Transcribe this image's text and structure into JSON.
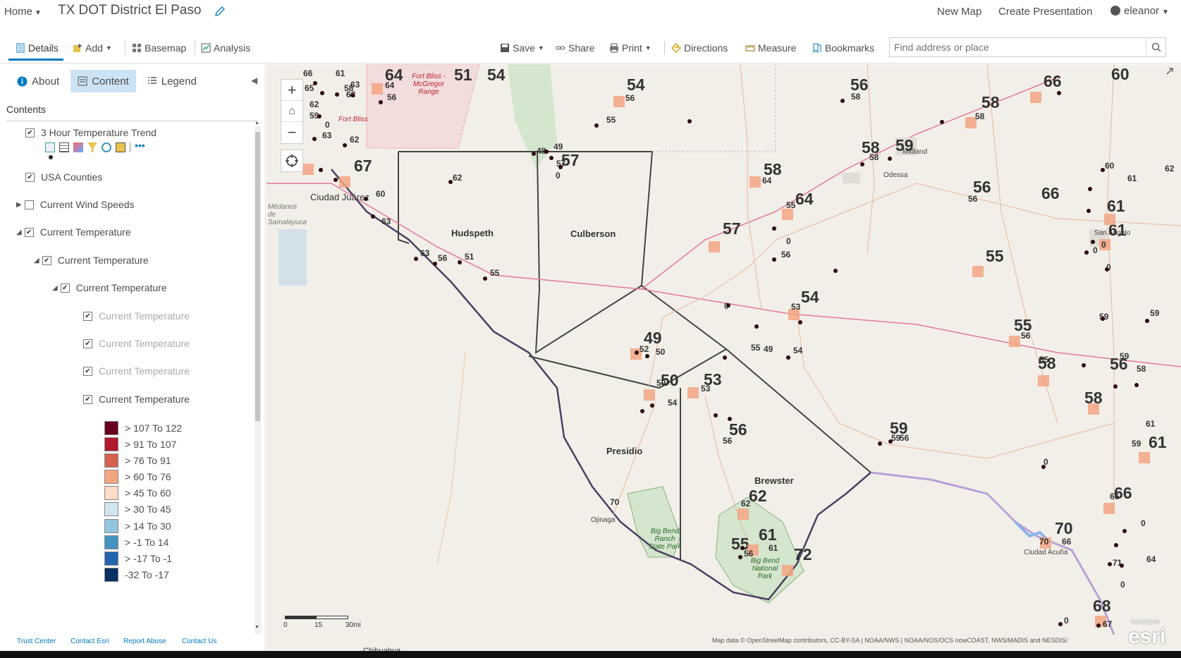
{
  "header": {
    "home_label": "Home",
    "map_title": "TX DOT District El Paso",
    "new_map": "New Map",
    "create_presentation": "Create Presentation",
    "user": "eleanor"
  },
  "toolbar": {
    "details": "Details",
    "add": "Add",
    "basemap": "Basemap",
    "analysis": "Analysis",
    "save": "Save",
    "share": "Share",
    "print": "Print",
    "directions": "Directions",
    "measure": "Measure",
    "bookmarks": "Bookmarks",
    "search_placeholder": "Find address or place"
  },
  "panel": {
    "tabs": [
      "About",
      "Content",
      "Legend"
    ],
    "contents_heading": "Contents",
    "layers": [
      {
        "label": "3 Hour Temperature Trend",
        "checked": true
      },
      {
        "label": "USA Counties",
        "checked": true
      },
      {
        "label": "Current Wind Speeds",
        "checked": false
      },
      {
        "label": "Current Temperature",
        "checked": true
      },
      {
        "label": "Current Temperature",
        "checked": true
      },
      {
        "label": "Current Temperature",
        "checked": true
      },
      {
        "label": "Current Temperature",
        "checked": true
      },
      {
        "label": "Current Temperature",
        "checked": true
      },
      {
        "label": "Current Temperature",
        "checked": true
      },
      {
        "label": "Current Temperature",
        "checked": true
      }
    ],
    "legend": [
      {
        "label": "> 107 To 122",
        "color": "#67001f"
      },
      {
        "label": "> 91 To 107",
        "color": "#b2182b"
      },
      {
        "label": "> 76 To 91",
        "color": "#d6604d"
      },
      {
        "label": "> 60 To 76",
        "color": "#f4a582"
      },
      {
        "label": "> 45 To 60",
        "color": "#fddbc7"
      },
      {
        "label": "> 30 To 45",
        "color": "#d1e5f0"
      },
      {
        "label": "> 14 To 30",
        "color": "#92c5de"
      },
      {
        "label": "> -1 To 14",
        "color": "#4393c3"
      },
      {
        "label": "> -17 To -1",
        "color": "#2166ac"
      },
      {
        "label": "-32 To -17",
        "color": "#053061"
      }
    ]
  },
  "footer": {
    "links": [
      "Trust Center",
      "Contact Esri",
      "Report Abuse",
      "Contact Us"
    ]
  },
  "map": {
    "places": [
      "Ciudad Juárez",
      "Hudspeth",
      "Culberson",
      "Presidio",
      "Brewster",
      "Odessa",
      "Midland",
      "San Angelo",
      "Ciudad Acuña",
      "Ojinaga",
      "Fort Bliss - McGregor Range",
      "Fort Bliss",
      "Big Bend Ranch State Park",
      "Big Bend National Park",
      "Médanos de Samalayuca",
      "Chihuahua"
    ],
    "big_temps": [
      "64",
      "51",
      "54",
      "54",
      "56",
      "66",
      "60",
      "58",
      "58",
      "59",
      "58",
      "56",
      "64",
      "66",
      "67",
      "57",
      "57",
      "61",
      "61",
      "55",
      "54",
      "55",
      "58",
      "56",
      "58",
      "49",
      "50",
      "53",
      "59",
      "56",
      "61",
      "62",
      "66",
      "70",
      "55",
      "61",
      "72",
      "68"
    ],
    "small_temps": [
      "66",
      "61",
      "65",
      "58",
      "63",
      "64",
      "56",
      "63",
      "62",
      "59",
      "0",
      "63",
      "62",
      "48",
      "49",
      "57",
      "0",
      "62",
      "60",
      "63",
      "63",
      "56",
      "51",
      "55",
      "55",
      "56",
      "58",
      "58",
      "58",
      "64",
      "56",
      "55",
      "0",
      "56",
      "60",
      "62",
      "61",
      "0",
      "0",
      "0",
      "59",
      "59",
      "56",
      "59",
      "53",
      "0",
      "55",
      "54",
      "50",
      "52",
      "49",
      "50",
      "54",
      "53",
      "56",
      "59",
      "56",
      "61",
      "0",
      "66",
      "0",
      "70",
      "66",
      "71",
      "64",
      "0",
      "0",
      "67",
      "62",
      "61",
      "56",
      "70",
      "55",
      "58",
      "59"
    ],
    "scale": {
      "labels": [
        "0",
        "15",
        "30mi"
      ]
    },
    "attribution": "Map data © OpenStreetMap contributors, CC-BY-SA | NOAA/NWS | NOAA/NOS/OCS nowCOAST, NWS/MADIS and NESDIS/",
    "logo_text": "esri",
    "logo_small": "POWERED BY"
  }
}
